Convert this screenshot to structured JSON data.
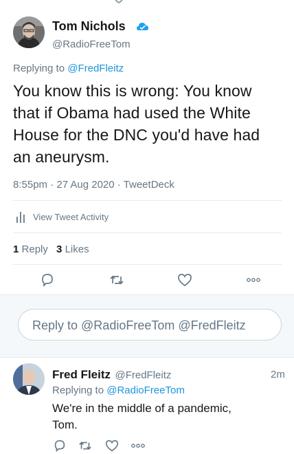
{
  "main_tweet": {
    "author_name": "Tom Nichols",
    "handle": "@RadioFreeTom",
    "verified_icon": "verified-badge-icon",
    "replying_prefix": "Replying to",
    "replying_to": "@FredFleitz",
    "text_lines": [
      "You know this is wrong: You know",
      "that if Obama had used the White",
      "House for the DNC you'd have had",
      "an aneurysm."
    ],
    "timestamp": "8:55pm · 27 Aug 2020 · TweetDeck",
    "activity_label": "View Tweet Activity",
    "reply_count": "1",
    "reply_label": "Reply",
    "like_count": "3",
    "like_label": "Likes"
  },
  "compose": {
    "placeholder": "Reply to @RadioFreeTom @FredFleitz"
  },
  "reply_tweet": {
    "author_name": "Fred Fleitz",
    "handle": "@FredFleitz",
    "time": "2m",
    "replying_prefix": "Replying to",
    "replying_to": "@RadioFreeTom",
    "text_lines": [
      "We're in the middle of a pandemic,",
      "Tom."
    ]
  },
  "colors": {
    "link_blue": "#1b95e0",
    "secondary_gray": "#657786",
    "divider": "#e6ecf0",
    "compose_bg": "#f5f8fa"
  },
  "icons": [
    "reply-icon",
    "retweet-icon",
    "like-icon",
    "more-icon",
    "activity-icon",
    "verified-badge-icon"
  ]
}
